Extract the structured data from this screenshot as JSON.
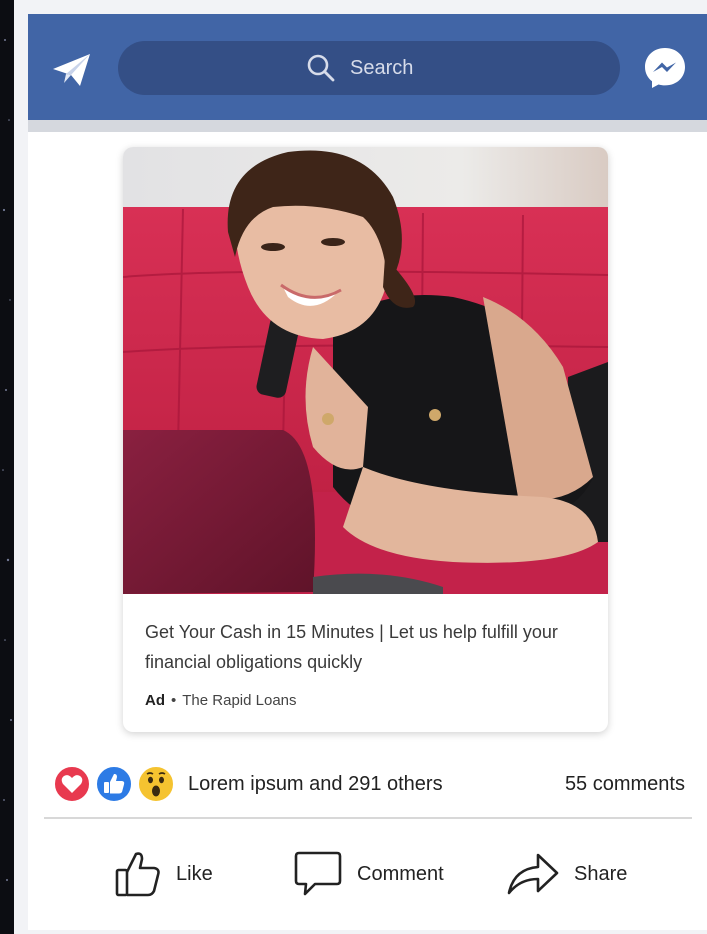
{
  "topbar": {
    "search_placeholder": "Search",
    "background_color": "#4165a6",
    "search_background_color": "#344f86",
    "left_icon": "paper-plane-icon",
    "right_icon": "messenger-icon"
  },
  "ad": {
    "headline": "Get Your Cash in 15 Minutes | Let us help fulfill your financial obligations quickly",
    "ad_label": "Ad",
    "separator": "•",
    "advertiser": "The Rapid Loans"
  },
  "reactions": {
    "icons": [
      "heart-react-icon",
      "like-react-icon",
      "wow-react-icon"
    ],
    "summary": "Lorem ipsum and  291 others",
    "comments": "55 comments"
  },
  "actions": {
    "like_label": "Like",
    "comment_label": "Comment",
    "share_label": "Share"
  }
}
